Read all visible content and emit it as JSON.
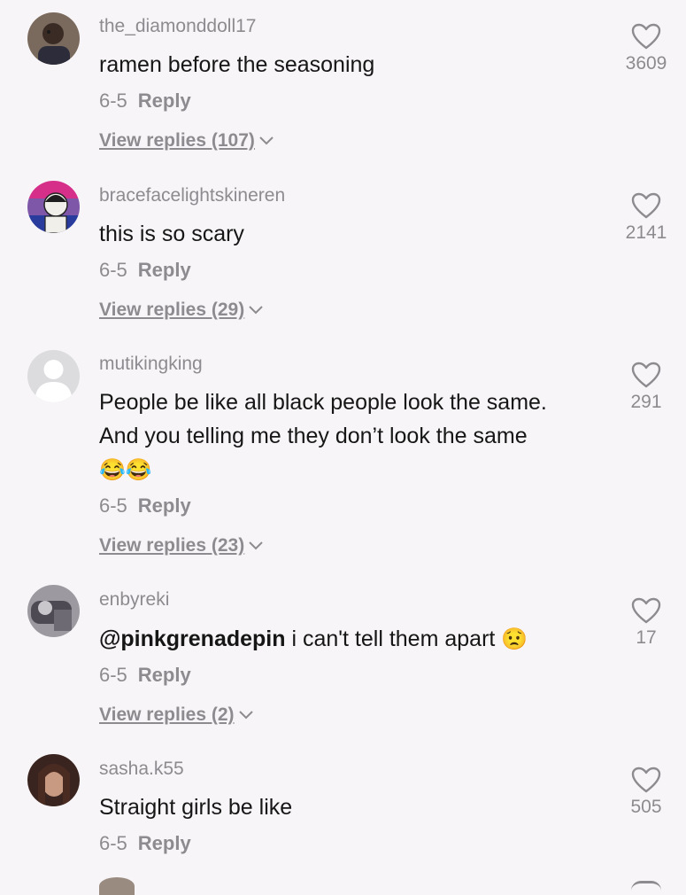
{
  "comments": [
    {
      "username": "the_diamonddoll17",
      "text": "ramen before the seasoning",
      "date": "6-5",
      "reply_label": "Reply",
      "view_replies": "View replies (107)",
      "likes": "3609",
      "avatar_icon": "user-photo-avatar"
    },
    {
      "username": "bracefacelightskineren",
      "text": "this is so scary",
      "date": "6-5",
      "reply_label": "Reply",
      "view_replies": "View replies (29)",
      "likes": "2141",
      "avatar_icon": "flag-character-avatar"
    },
    {
      "username": "mutikingking",
      "text": "People be like all black people look the same.\nAnd you telling me they don’t look the same",
      "emojis": "😂😂",
      "date": "6-5",
      "reply_label": "Reply",
      "view_replies": "View replies (23)",
      "likes": "291",
      "avatar_icon": "default-user-avatar"
    },
    {
      "username": "enbyreki",
      "mention": "@pinkgrenadepin",
      "text": " i can't tell them apart ",
      "emojis": "😟",
      "date": "6-5",
      "reply_label": "Reply",
      "view_replies": "View replies (2)",
      "likes": "17",
      "avatar_icon": "user-photo-avatar"
    },
    {
      "username": "sasha.k55",
      "text": "Straight girls be like",
      "date": "6-5",
      "reply_label": "Reply",
      "likes": "505",
      "avatar_icon": "user-photo-avatar"
    }
  ],
  "icons": {
    "like": "heart-outline-icon",
    "expand": "chevron-down-icon"
  },
  "colors": {
    "background": "#f7f5f7",
    "muted": "#8d8b8f",
    "text": "#161616"
  }
}
